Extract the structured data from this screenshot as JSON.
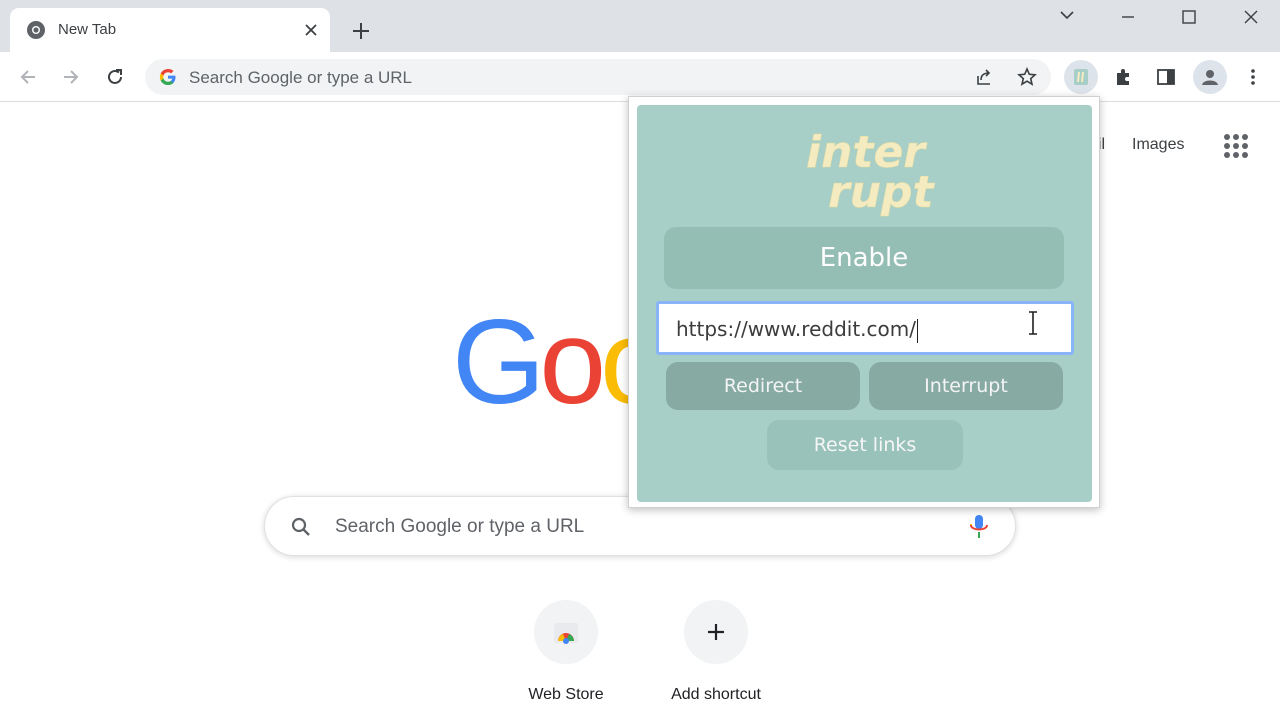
{
  "tab": {
    "title": "New Tab",
    "icon": "chrome-icon",
    "close_icon": "close-icon"
  },
  "window_controls": {
    "icons": [
      "chevron-down-icon",
      "minimize-icon",
      "maximize-icon",
      "close-icon"
    ]
  },
  "toolbar": {
    "nav_icons": [
      "back-arrow-icon",
      "forward-arrow-icon",
      "reload-icon"
    ],
    "omnibox_placeholder": "Search Google or type a URL",
    "right_icons": [
      "share-icon",
      "star-icon",
      "interrupt-extension-icon",
      "puzzle-icon",
      "side-panel-icon",
      "profile-icon",
      "more-vert-icon"
    ]
  },
  "ntp": {
    "top_links": {
      "gmail": "ail",
      "images": "Images"
    },
    "logo": {
      "letters": [
        "G",
        "o",
        "o"
      ],
      "colors": [
        "#4285f4",
        "#ea4335",
        "#fbbc05"
      ]
    },
    "search_placeholder": "Search Google or type a URL",
    "shortcuts": [
      {
        "label": "Web Store",
        "icon": "web-store-icon"
      },
      {
        "label": "Add shortcut",
        "icon": "plus-icon"
      }
    ]
  },
  "popup": {
    "logo_text_line1": "inter",
    "logo_text_line2": "rupt",
    "enable_label": "Enable",
    "url_value": "https://www.reddit.com/",
    "redirect_label": "Redirect",
    "interrupt_label": "Interrupt",
    "reset_label": "Reset links",
    "colors": {
      "panel": "#a7cfc8",
      "enable": "#94bdb4",
      "action": "#87aaa2",
      "reset": "#99c2ba",
      "logo": "#f4ecc0"
    }
  }
}
